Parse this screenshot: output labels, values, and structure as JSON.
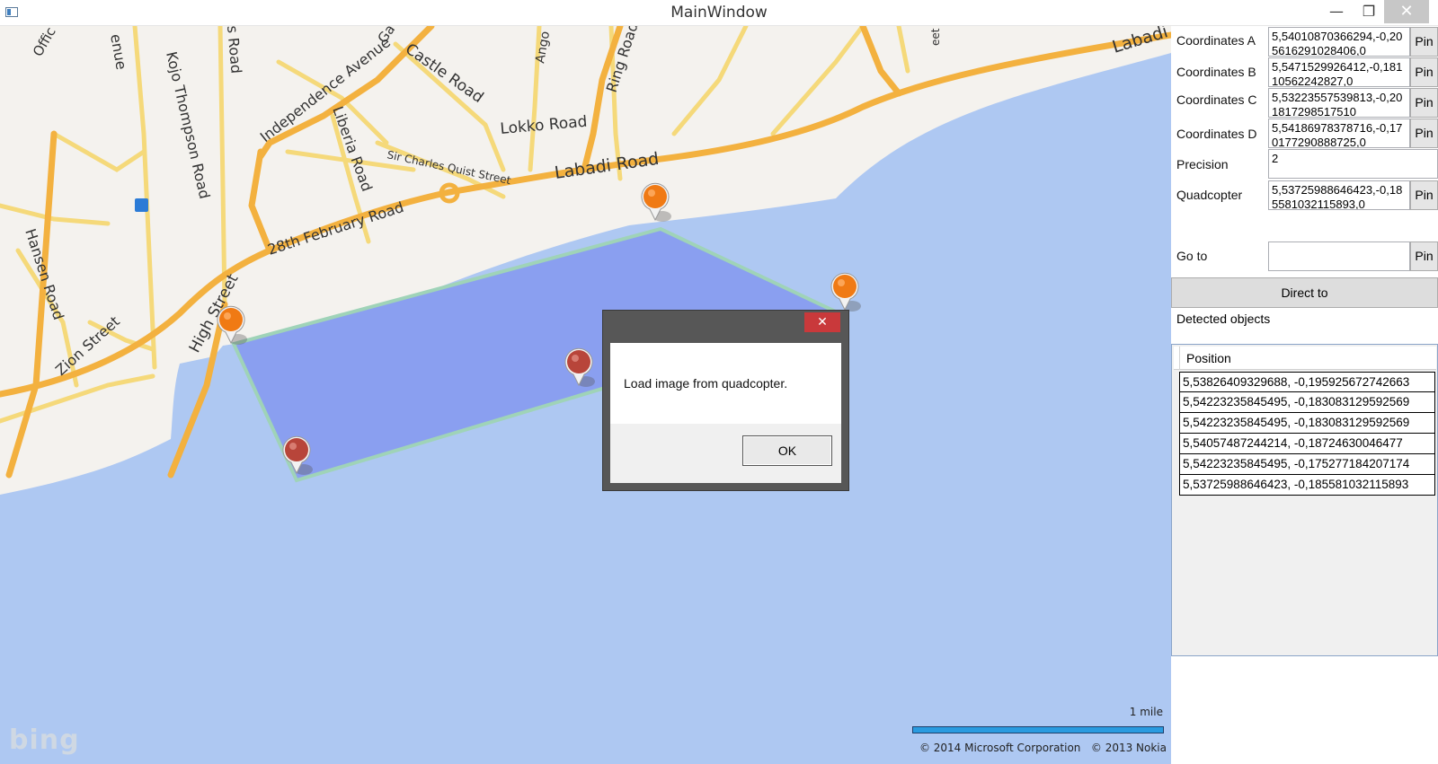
{
  "window": {
    "title": "MainWindow",
    "minimize_glyph": "—",
    "maximize_glyph": "❐",
    "close_glyph": "✕"
  },
  "map": {
    "road_labels": {
      "labadi_road": "Labadi Road",
      "labadi_road_east": "Labadi",
      "lokko_road": "Lokko Road",
      "castle_road": "Castle Road",
      "ring_road": "Ring Road",
      "independence_avenue": "Independence Avenue",
      "liberia_road": "Liberia Road",
      "sir_charles_quist_street": "Sir Charles Quist Street",
      "feb28_road": "28th February Road",
      "high_street": "High Street",
      "zion_street": "Zion Street",
      "hansen_road": "Hansen Road",
      "kojo_thompson_road": "Kojo Thompson Road",
      "enue": "enue",
      "offic": "Offic",
      "s_road": "s Road",
      "ga": "Ga",
      "ango": "Ango",
      "eet": "eet"
    },
    "logo": "bing",
    "scale_label": "1 mile",
    "copyright_microsoft": "© 2014 Microsoft Corporation",
    "copyright_nokia": "© 2013 Nokia",
    "colors": {
      "water": "#aec8f2",
      "land": "#f4f2ee",
      "area_fill": "#8a9ff0",
      "area_border": "#9fd3b8",
      "pin_orange": "#f07a14",
      "pin_red": "#b8453a",
      "road_major": "#f3b13f",
      "road_secondary": "#f5d97a"
    }
  },
  "message_box": {
    "close_glyph": "✕",
    "message": "Load image from quadcopter.",
    "ok_label": "OK"
  },
  "panel": {
    "coord_a": {
      "label": "Coordinates A",
      "value": "5,54010870366294,-0,205616291028406,0",
      "button": "Pin"
    },
    "coord_b": {
      "label": "Coordinates B",
      "value": "5,5471529926412,-0,18110562242827,0",
      "button": "Pin"
    },
    "coord_c": {
      "label": "Coordinates C",
      "value": "5,53223557539813,-0,201817298517510",
      "button": "Pin"
    },
    "coord_d": {
      "label": "Coordinates D",
      "value": "5,54186978378716,-0,170177290888725,0",
      "button": "Pin"
    },
    "precision": {
      "label": "Precision",
      "value": "2"
    },
    "quadcopter": {
      "label": "Quadcopter",
      "value": "5,53725988646423,-0,185581032115893,0",
      "button": "Pin"
    },
    "goto": {
      "label": "Go to",
      "value": "",
      "button": "Pin"
    },
    "direct_to": "Direct to",
    "detected_label": "Detected objects",
    "grid": {
      "column_header": "Position",
      "rows": [
        "5,53826409329688, -0,195925672742663",
        "5,54223235845495, -0,183083129592569",
        "5,54223235845495, -0,183083129592569",
        "5,54057487244214, -0,18724630046477",
        "5,54223235845495, -0,175277184207174",
        "5,53725988646423, -0,185581032115893"
      ]
    }
  }
}
